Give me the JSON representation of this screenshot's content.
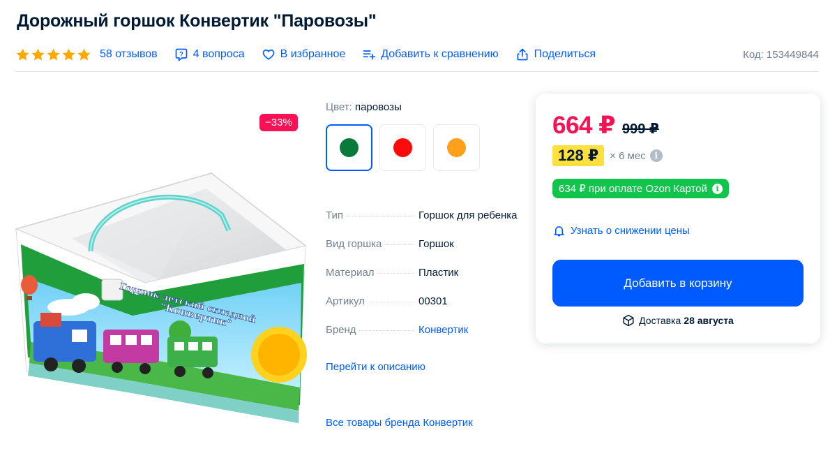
{
  "product": {
    "title": "Дорожный горшок Конвертик \"Паровозы\"",
    "rating_stars": 5,
    "reviews": "58 отзывов",
    "questions": "4 вопроса",
    "favorite": "В избранное",
    "compare": "Добавить к сравнению",
    "share": "Поделиться",
    "code": "Код: 153449844",
    "discount": "−33%",
    "image_text": {
      "line1": "Горшок детский складной",
      "line2": "\"Конвертик\""
    }
  },
  "color": {
    "label": "Цвет:",
    "value": "паровозы",
    "swatches": [
      "#0a7a3c",
      "#ff0a0a",
      "#ff9f1a"
    ]
  },
  "specs": [
    {
      "key": "Тип",
      "value": "Горшок для ребенка"
    },
    {
      "key": "Вид горшка",
      "value": "Горшок"
    },
    {
      "key": "Материал",
      "value": "Пластик"
    },
    {
      "key": "Артикул",
      "value": "00301"
    },
    {
      "key": "Бренд",
      "value": "Конвертик"
    }
  ],
  "links": {
    "description": "Перейти к описанию",
    "brand_all": "Все товары бренда Конвертик"
  },
  "buy": {
    "price": "664 ₽",
    "old_price": "999 ₽",
    "installment": "128 ₽",
    "installment_term": "× 6 мес",
    "card_price": "634 ₽ при оплате Ozon Картой",
    "notify": "Узнать о снижении цены",
    "cart_button": "Добавить в корзину",
    "delivery_label": "Доставка",
    "delivery_date": "28 августа"
  },
  "colors": {
    "accent": "#005bff",
    "sale": "#f91155",
    "star": "#ffa800",
    "installment_bg": "#ffe03f",
    "ozon_card": "#10c44c"
  }
}
